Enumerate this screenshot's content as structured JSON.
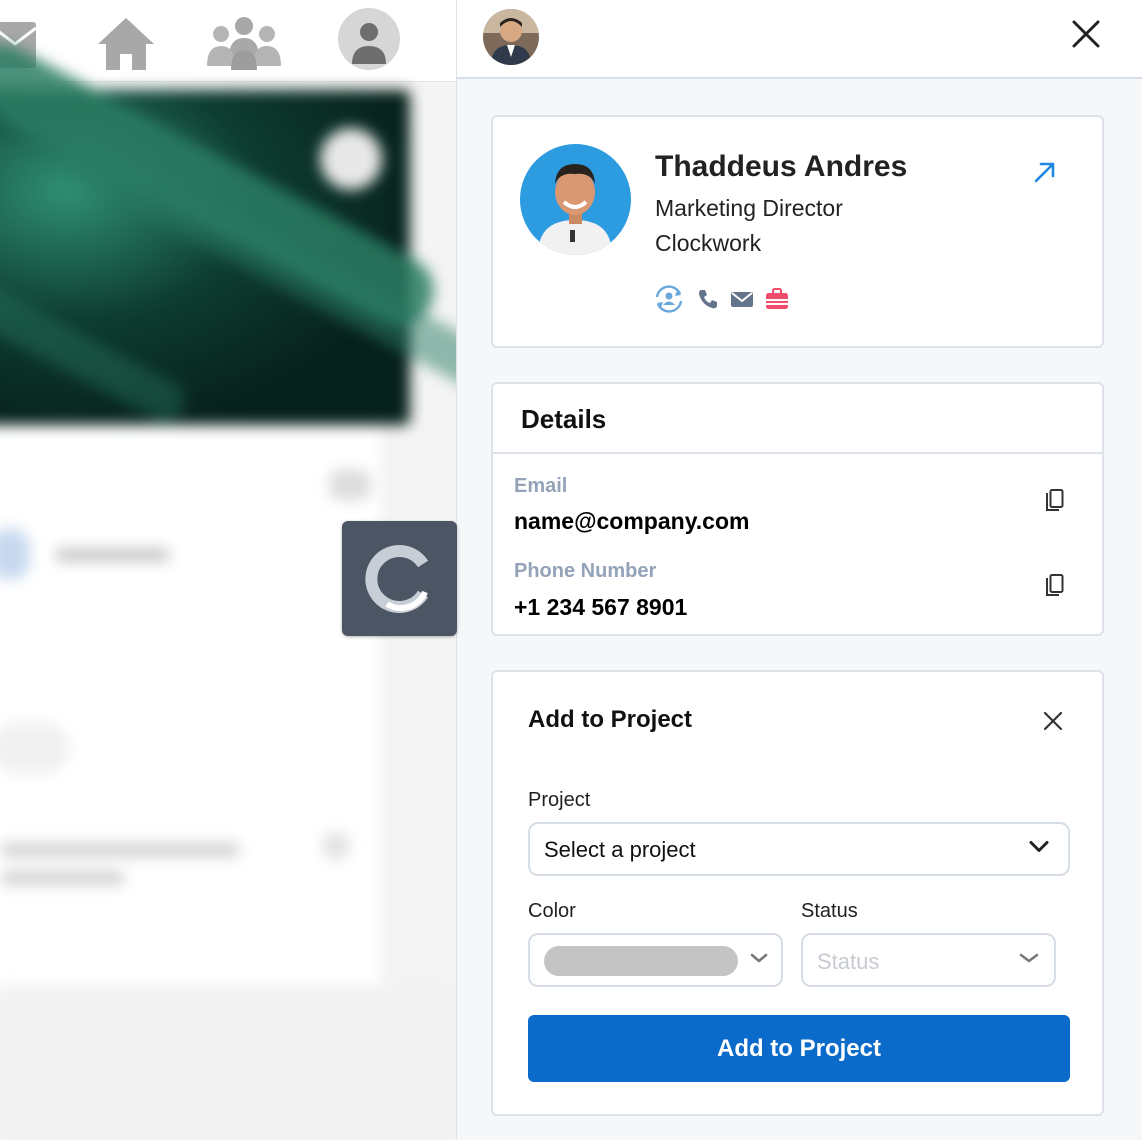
{
  "profile": {
    "name": "Thaddeus Andres",
    "title": "Marketing Director",
    "company": "Clockwork",
    "action_icons": [
      "sync-person-icon",
      "phone-icon",
      "mail-icon",
      "briefcase-icon"
    ]
  },
  "details": {
    "heading": "Details",
    "email_label": "Email",
    "email_value": "name@company.com",
    "phone_label": "Phone Number",
    "phone_value": "+1 234 567 8901"
  },
  "add_project": {
    "heading": "Add to Project",
    "project_label": "Project",
    "project_placeholder": "Select a project",
    "color_label": "Color",
    "status_label": "Status",
    "status_placeholder": "Status",
    "submit_label": "Add to Project"
  },
  "colors": {
    "accent": "#0b6bcb",
    "link_arrow": "#1e88e5",
    "muted_label": "#94a3b8",
    "briefcase": "#ef4d6b",
    "logo_bg": "#4b5563"
  }
}
